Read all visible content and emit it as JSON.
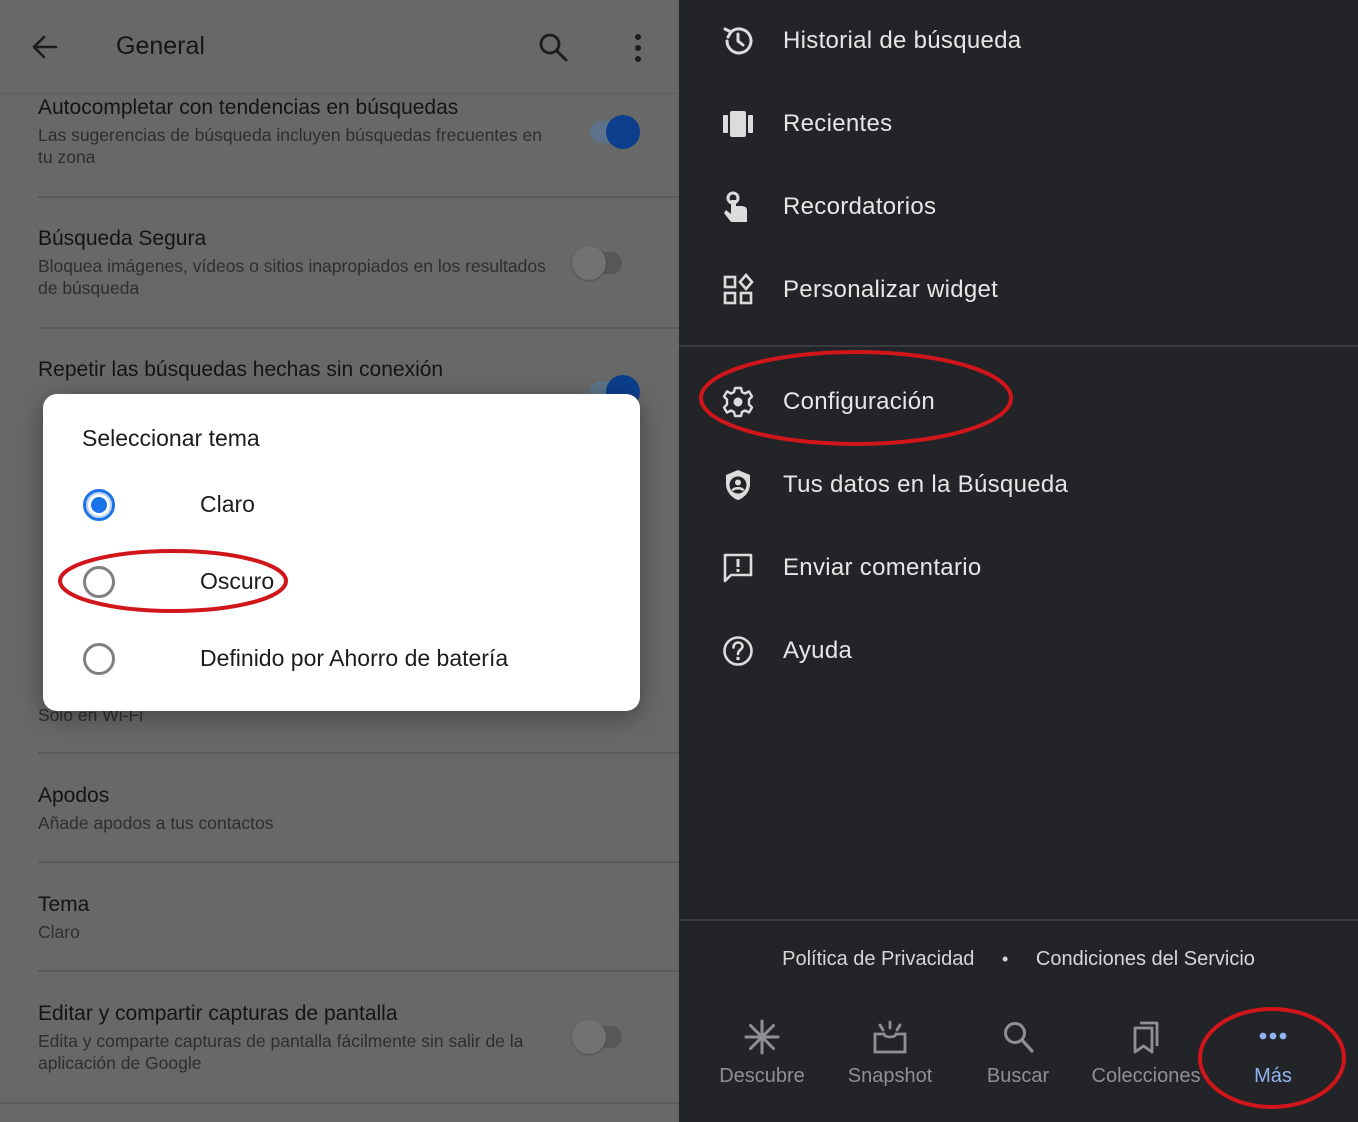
{
  "left_panel": {
    "appbar": {
      "title": "General",
      "back_icon": "arrow-back-icon",
      "search_icon": "search-icon",
      "more_icon": "more-vert-icon"
    },
    "settings": [
      {
        "title": "Autocompletar con tendencias en búsquedas",
        "description": "Las sugerencias de búsqueda incluyen búsquedas frecuentes en tu zona",
        "toggle": true
      },
      {
        "title": "Búsqueda Segura",
        "description": "Bloquea imágenes, vídeos o sitios inapropiados en los resultados de búsqueda",
        "toggle": false
      },
      {
        "title": "Repetir las búsquedas hechas sin conexión",
        "description": "",
        "toggle": true
      },
      {
        "title": "",
        "description": "Solo en Wi-Fi"
      },
      {
        "title": "Apodos",
        "description": "Añade apodos a tus contactos"
      },
      {
        "title": "Tema",
        "description": "Claro"
      },
      {
        "title": "Editar y compartir capturas de pantalla",
        "description": "Edita y comparte capturas de pantalla fácilmente sin salir de la aplicación de Google",
        "toggle": false
      }
    ],
    "dialog": {
      "title": "Seleccionar tema",
      "options": [
        {
          "label": "Claro",
          "selected": true
        },
        {
          "label": "Oscuro",
          "selected": false,
          "highlighted": true
        },
        {
          "label": "Definido por Ahorro de batería",
          "selected": false
        }
      ]
    }
  },
  "right_panel": {
    "menu_top": [
      {
        "label": "Historial de búsqueda",
        "icon": "history-icon"
      },
      {
        "label": "Recientes",
        "icon": "recents-icon"
      },
      {
        "label": "Recordatorios",
        "icon": "reminder-hand-icon"
      },
      {
        "label": "Personalizar widget",
        "icon": "widgets-icon"
      }
    ],
    "menu_bottom": [
      {
        "label": "Configuración",
        "icon": "gear-icon",
        "highlighted": true
      },
      {
        "label": "Tus datos en la Búsqueda",
        "icon": "shield-person-icon"
      },
      {
        "label": "Enviar comentario",
        "icon": "feedback-icon"
      },
      {
        "label": "Ayuda",
        "icon": "help-icon"
      }
    ],
    "footer": {
      "privacy": "Política de Privacidad",
      "separator": "•",
      "terms": "Condiciones del Servicio"
    },
    "bottom_nav": [
      {
        "label": "Descubre",
        "icon": "discover-icon",
        "active": false
      },
      {
        "label": "Snapshot",
        "icon": "snapshot-icon",
        "active": false
      },
      {
        "label": "Buscar",
        "icon": "search-icon",
        "active": false
      },
      {
        "label": "Colecciones",
        "icon": "collections-icon",
        "active": false
      },
      {
        "label": "Más",
        "icon": "more-horiz-icon",
        "active": true,
        "highlighted": true
      }
    ]
  },
  "colors": {
    "accent_blue": "#1a73e8",
    "active_nav": "#8fb3f0",
    "annotation_red": "#d0161b",
    "dark_bg": "#232427",
    "scrim_bg": "#686868"
  }
}
